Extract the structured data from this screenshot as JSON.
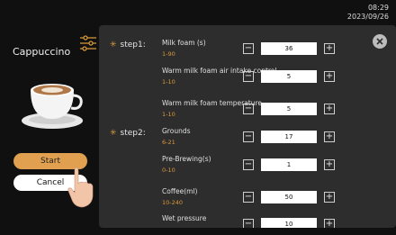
{
  "clock": {
    "time": "08:29",
    "date": "2023/09/26"
  },
  "left": {
    "drink_name": "Cappuccino",
    "start_label": "Start",
    "cancel_label": "Cancel"
  },
  "steps": [
    {
      "label": "step1:"
    },
    {
      "label": "step2:"
    }
  ],
  "params": [
    {
      "name": "Milk foam (s)",
      "range": "1-90",
      "value": "36"
    },
    {
      "name": "Warm milk foam air intake control",
      "range": "1-10",
      "value": "5"
    },
    {
      "name": "Warm milk foam temperature",
      "range": "1-10",
      "value": "5"
    },
    {
      "name": "Grounds",
      "range": "6-21",
      "value": "17"
    },
    {
      "name": "Pre-Brewing(s)",
      "range": "0-10",
      "value": "1"
    },
    {
      "name": "Coffee(ml)",
      "range": "10-240",
      "value": "50"
    },
    {
      "name": "Wet pressure",
      "range": "",
      "value": "10"
    }
  ],
  "stepper": {
    "minus": "−",
    "plus": "+"
  },
  "colors": {
    "accent": "#d99a3a",
    "start": "#e0a050",
    "panel": "#2d2d2d",
    "background": "#101010"
  },
  "icons": {
    "close": "close-icon",
    "settings": "settings-sliders-icon",
    "step": "sun-icon"
  }
}
